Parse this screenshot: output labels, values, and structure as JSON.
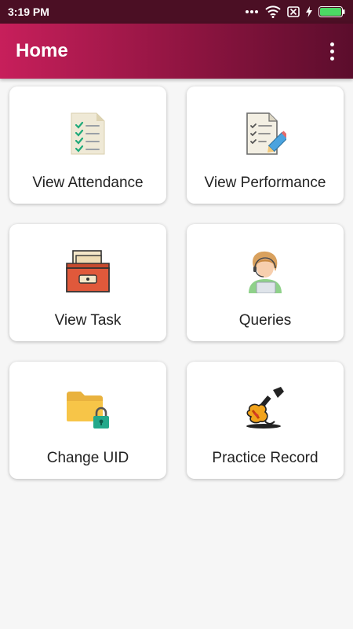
{
  "status_bar": {
    "time": "3:19 PM",
    "icons": [
      "dots-icon",
      "wifi-icon",
      "no-sim-icon",
      "charging-icon",
      "battery-icon"
    ],
    "battery_color": "#4cd964"
  },
  "app_bar": {
    "title": "Home",
    "menu_icon": "kebab-menu-icon",
    "gradient": [
      "#c71f5b",
      "#5b0d2c"
    ]
  },
  "tiles": [
    {
      "label": "View Attendance",
      "icon": "attendance-checklist-icon"
    },
    {
      "label": "View Performance",
      "icon": "performance-report-icon"
    },
    {
      "label": "View Task",
      "icon": "task-drawer-icon"
    },
    {
      "label": "Queries",
      "icon": "support-agent-icon"
    },
    {
      "label": "Change UID",
      "icon": "locked-folder-icon"
    },
    {
      "label": "Practice Record",
      "icon": "guitar-icon"
    }
  ]
}
